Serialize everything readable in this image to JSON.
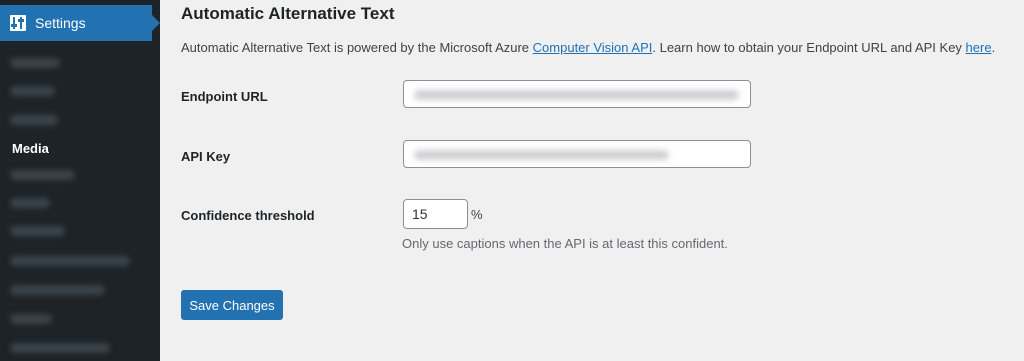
{
  "sidebar": {
    "settings_label": "Settings",
    "settings_icon": "settings-sliders-icon",
    "active_item": "Media",
    "accent_color": "#2271b1",
    "background_color": "#1d2327"
  },
  "section": {
    "title": "Automatic Alternative Text",
    "description_prefix": "Automatic Alternative Text is powered by the Microsoft Azure ",
    "description_link1": "Computer Vision API",
    "description_middle": ". Learn how to obtain your Endpoint URL and API Key ",
    "description_link2": "here",
    "description_suffix": "."
  },
  "fields": {
    "endpoint_label": "Endpoint URL",
    "api_key_label": "API Key",
    "confidence_label": "Confidence threshold",
    "confidence_value": "15",
    "confidence_unit": "%",
    "confidence_help": "Only use captions when the API is at least this confident."
  },
  "actions": {
    "save_label": "Save Changes"
  }
}
